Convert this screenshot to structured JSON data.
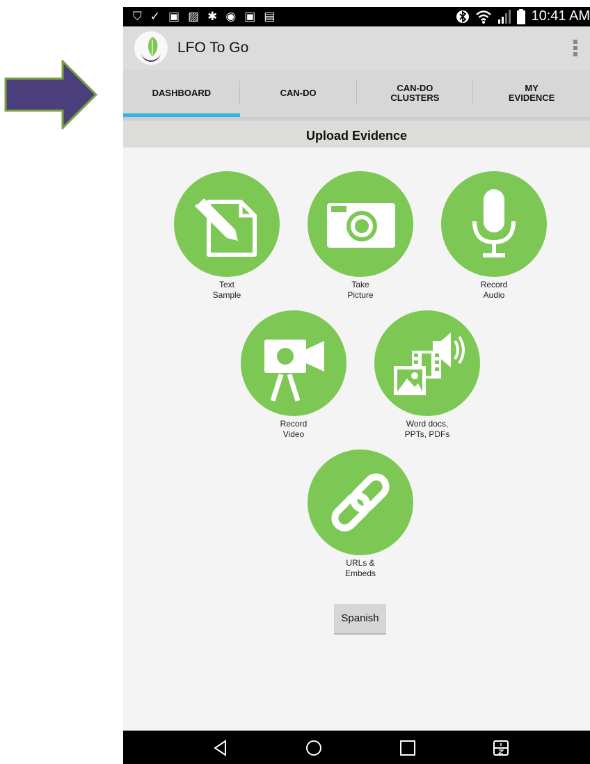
{
  "status_bar": {
    "time": "10:41 AM"
  },
  "app": {
    "title": "LFO To Go"
  },
  "tabs": [
    {
      "line1": "DASHBOARD",
      "line2": ""
    },
    {
      "line1": "CAN-DO",
      "line2": ""
    },
    {
      "line1": "CAN-DO",
      "line2": "CLUSTERS"
    },
    {
      "line1": "MY",
      "line2": "EVIDENCE"
    }
  ],
  "section": {
    "title": "Upload Evidence"
  },
  "options": [
    {
      "line1": "Text",
      "line2": "Sample",
      "icon": "document-pencil-icon"
    },
    {
      "line1": "Take",
      "line2": "Picture",
      "icon": "camera-icon"
    },
    {
      "line1": "Record",
      "line2": "Audio",
      "icon": "microphone-icon"
    },
    {
      "line1": "Record",
      "line2": "Video",
      "icon": "video-camera-icon"
    },
    {
      "line1": "Word docs,",
      "line2": "PPTs, PDFs",
      "icon": "media-files-icon"
    },
    {
      "line1": "URLs &",
      "line2": "Embeds",
      "icon": "link-icon"
    }
  ],
  "language_button": "Spanish",
  "colors": {
    "accent": "#33b5e5",
    "option_green": "#7dc855",
    "arrow_fill": "#4a3f7c",
    "arrow_border": "#7aa340"
  }
}
